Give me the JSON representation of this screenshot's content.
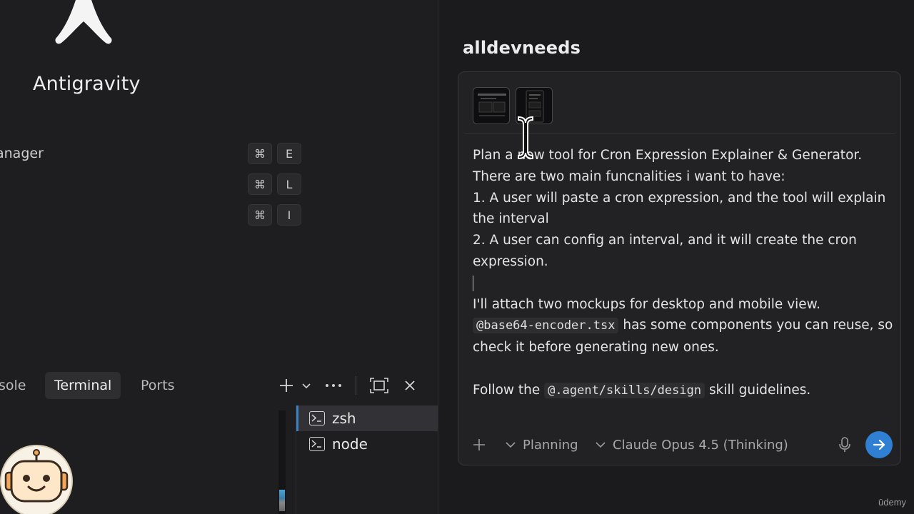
{
  "app": {
    "name": "Antigravity"
  },
  "shortcuts": [
    {
      "label": "anager",
      "modifier": "⌘",
      "key": "E"
    },
    {
      "label": "",
      "modifier": "⌘",
      "key": "L"
    },
    {
      "label": "",
      "modifier": "⌘",
      "key": "I"
    }
  ],
  "panel": {
    "tabs": [
      {
        "label": "sole",
        "active": false
      },
      {
        "label": "Terminal",
        "active": true
      },
      {
        "label": "Ports",
        "active": false
      }
    ],
    "terminals": [
      {
        "label": "zsh",
        "selected": true
      },
      {
        "label": "node",
        "selected": false
      }
    ]
  },
  "workspace": {
    "title": "alldevneeds"
  },
  "composer": {
    "line1": "Plan a new tool for Cron Expression Explainer & Generator.",
    "line2": "There are two main funcnalities i want to have:",
    "line3": "1. A user will paste a cron expression, and the tool will explain the interval",
    "line4": "2. A user can config an interval, and it will create the cron expression.",
    "line5": "I'll attach two mockups for desktop and mobile view.",
    "mention1": "@base64-encoder.tsx",
    "line6_rest": " has some components you can reuse, so check it before generating new ones.",
    "line7_pre": "Follow the ",
    "mention2": "@.agent/skills/design",
    "line7_post": " skill guidelines.",
    "mode": "Planning",
    "model": "Claude Opus 4.5 (Thinking)"
  },
  "watermark": "ūdemy",
  "colors": {
    "accent": "#2f7fd3",
    "selection": "#3b82c4",
    "background": "#1b1b1d"
  }
}
